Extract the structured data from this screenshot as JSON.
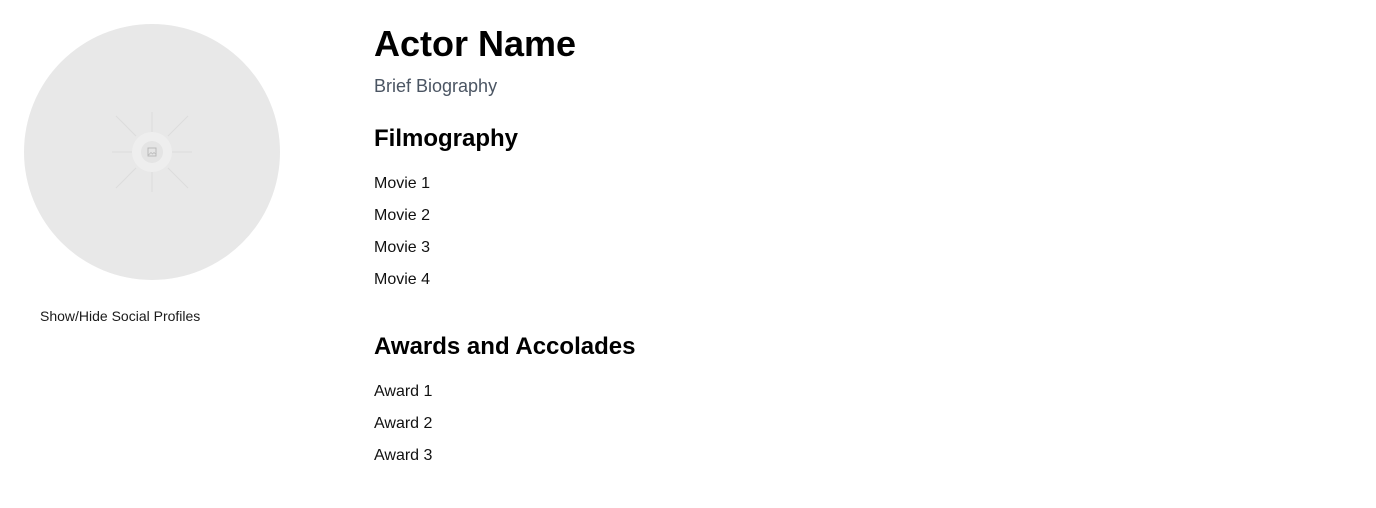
{
  "profile": {
    "social_toggle_label": "Show/Hide Social Profiles"
  },
  "main": {
    "actor_name": "Actor Name",
    "biography": "Brief Biography",
    "filmography": {
      "title": "Filmography",
      "items": [
        "Movie 1",
        "Movie 2",
        "Movie 3",
        "Movie 4"
      ]
    },
    "awards": {
      "title": "Awards and Accolades",
      "items": [
        "Award 1",
        "Award 2",
        "Award 3"
      ]
    }
  },
  "colors": {
    "avatar_background": "#e8e8e8",
    "biography_text": "#4b5563"
  },
  "icons": {
    "avatar_placeholder": "image-placeholder-icon"
  }
}
